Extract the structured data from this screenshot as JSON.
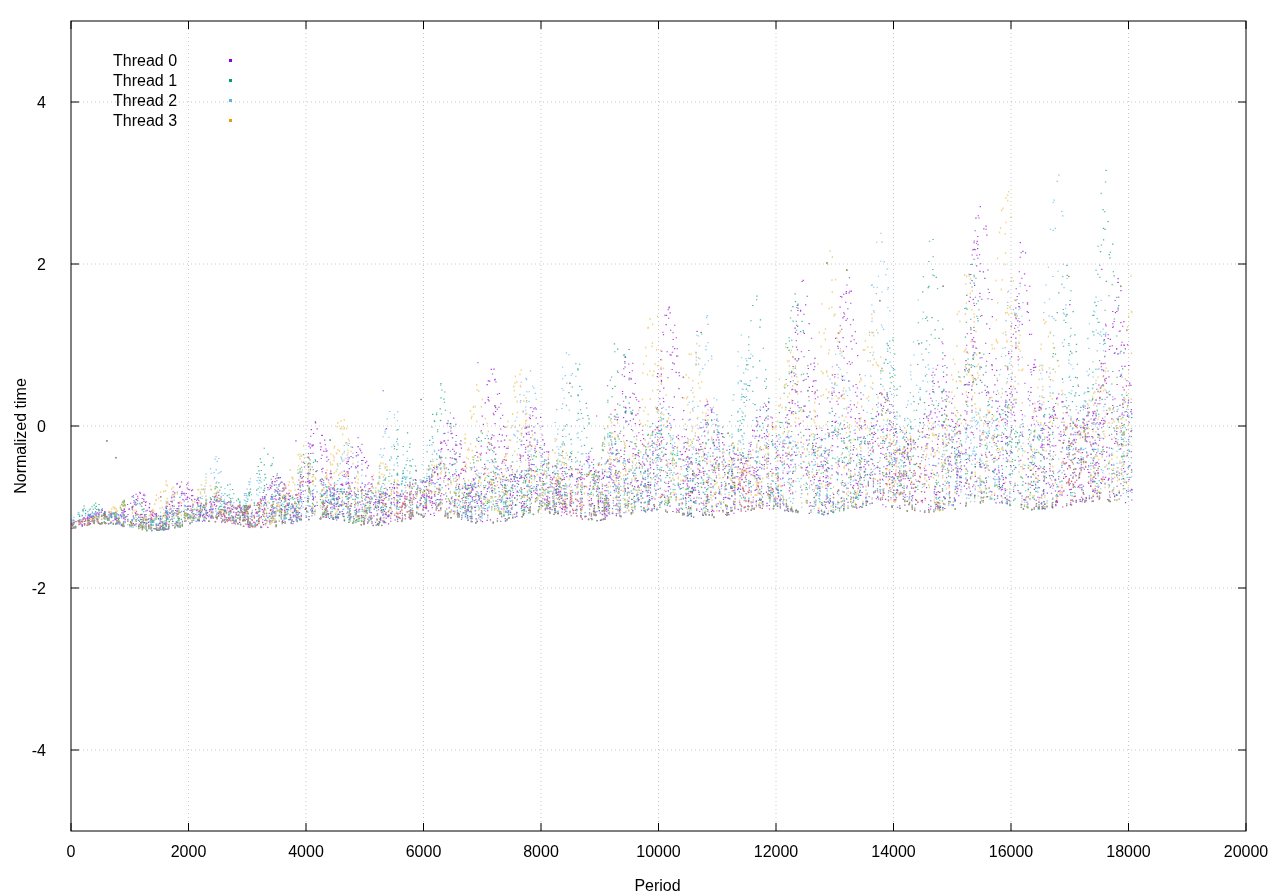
{
  "plot": {
    "x_axis": {
      "label": "Period",
      "ticks": [
        "0",
        "2000",
        "4000",
        "6000",
        "8000",
        "10000",
        "12000",
        "14000",
        "16000",
        "18000",
        "20000"
      ]
    },
    "y_axis": {
      "label": "Normalized time",
      "ticks": [
        "4",
        "2",
        "0",
        "-2",
        "-4"
      ]
    },
    "legend": [
      {
        "name": "Thread 0",
        "color": "#9400d3"
      },
      {
        "name": "Thread 1",
        "color": "#009e73"
      },
      {
        "name": "Thread 2",
        "color": "#56b4e9"
      },
      {
        "name": "Thread 3",
        "color": "#e69f00"
      }
    ]
  }
}
